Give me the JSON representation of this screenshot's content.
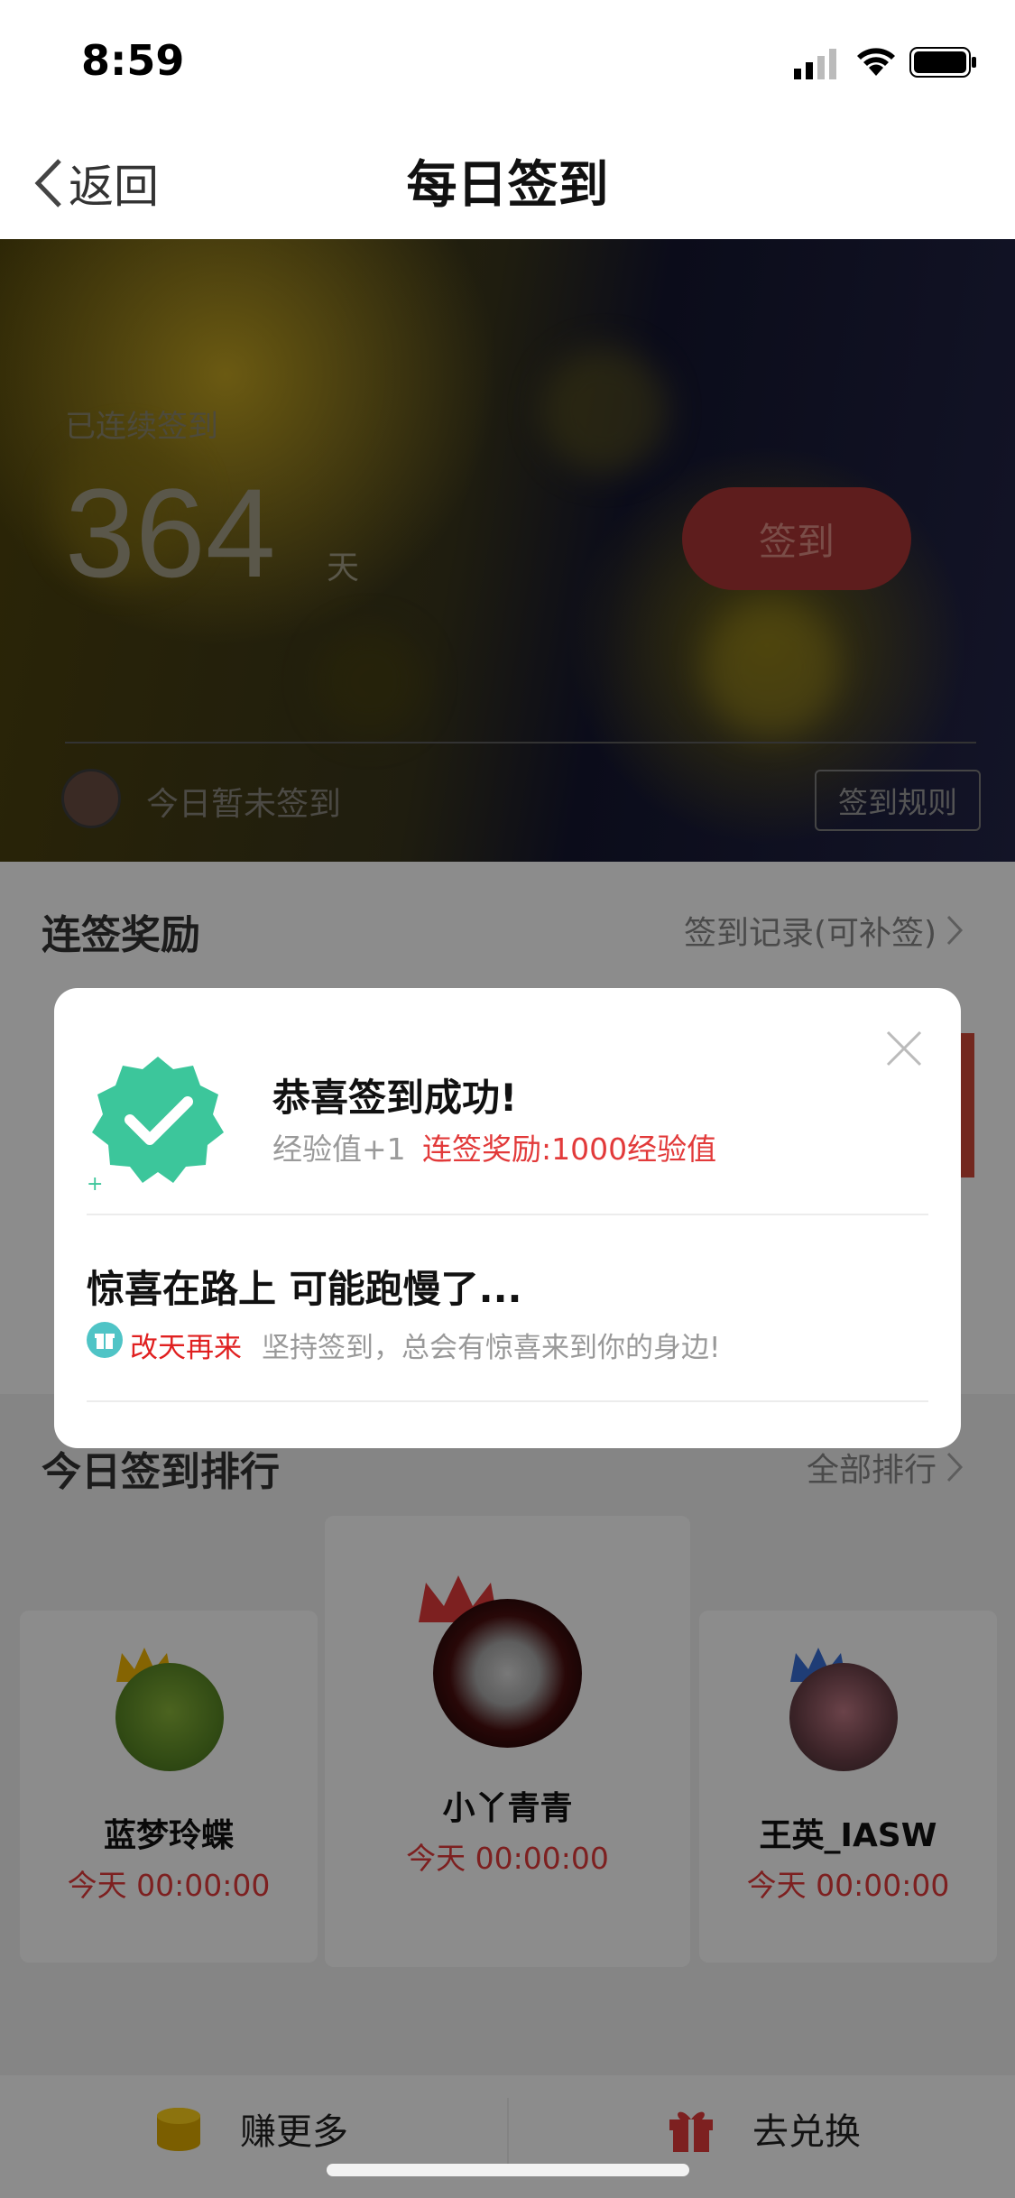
{
  "status_bar": {
    "time": "8:59"
  },
  "nav": {
    "back_label": "返回",
    "title": "每日签到"
  },
  "hero": {
    "label": "已连续签到",
    "count": "364",
    "unit": "天",
    "checkin_button": "签到",
    "today_status": "今日暂未签到",
    "rules_button": "签到规则"
  },
  "rewards": {
    "title": "连签奖励",
    "link": "签到记录(可补签)"
  },
  "ranking": {
    "title": "今日签到排行",
    "link": "全部排行",
    "users": [
      {
        "name": "蓝梦玲蝶",
        "time": "今天 00:00:00"
      },
      {
        "name": "小丫青青",
        "time": "今天 00:00:00"
      },
      {
        "name": "王英_IASW",
        "time": "今天 00:00:00"
      }
    ]
  },
  "bottom_bar": {
    "earn_label": "赚更多",
    "exchange_label": "去兑换"
  },
  "modal": {
    "title": "恭喜签到成功!",
    "exp": "经验值+1",
    "streak_reward": "连签奖励:1000经验值",
    "surprise_title": "惊喜在路上 可能跑慢了...",
    "comeback": "改天再来",
    "keep_text": "坚持签到，总会有惊喜来到你的身边!"
  },
  "colors": {
    "accent_red": "#e23a3a",
    "badge_green": "#3cc69b",
    "gift_teal": "#4fc4c6"
  }
}
